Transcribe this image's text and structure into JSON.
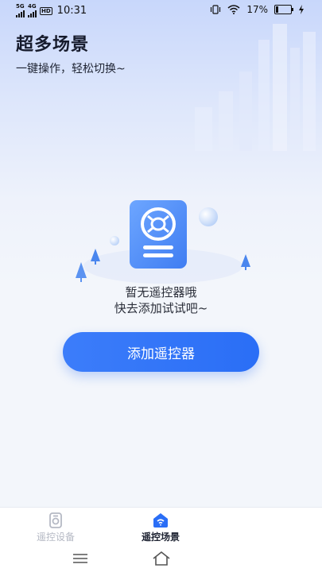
{
  "status_bar": {
    "network_1": "5G",
    "network_2": "4G",
    "hd_badge": "HD",
    "time": "10:31",
    "battery": "17%"
  },
  "header": {
    "title": "超多场景",
    "subtitle": "一键操作，轻松切换~"
  },
  "empty_state": {
    "line1": "暂无遥控器哦",
    "line2": "快去添加试试吧~"
  },
  "add_button": {
    "label": "添加遥控器"
  },
  "bottom_nav": {
    "tabs": [
      {
        "label": "遥控设备",
        "icon": "remote-device-icon",
        "active": false
      },
      {
        "label": "遥控场景",
        "icon": "remote-scene-icon",
        "active": true
      }
    ]
  },
  "colors": {
    "accent": "#2a6ef6",
    "inactive_tab": "#b5b9c4"
  }
}
